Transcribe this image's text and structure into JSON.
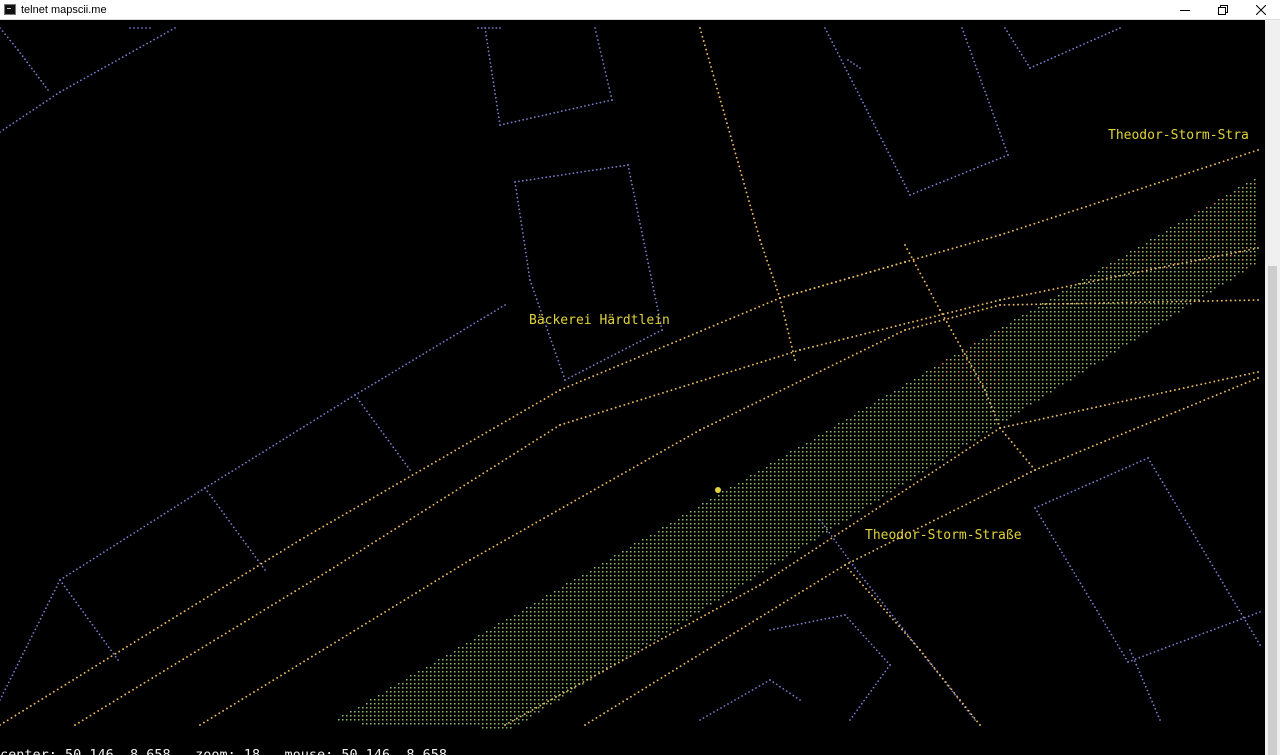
{
  "window": {
    "title": "telnet mapscii.me",
    "icon": "terminal-icon",
    "controls": [
      "minimize-icon",
      "restore-icon",
      "close-icon"
    ]
  },
  "map": {
    "labels": [
      {
        "text": "Theodor-Storm-Stra"
      },
      {
        "text": "Bäckerei Härdtlein"
      },
      {
        "text": "Theodor-Storm-Straße"
      }
    ],
    "colors": {
      "building": "#7c7ccc",
      "road": "#e8b860",
      "park": "#8fbf70",
      "label": "#e0d23c",
      "marker": "#e0d23c"
    }
  },
  "status": {
    "text": "center: 50.146, 8.658   zoom: 18   mouse: 50.146, 8.658"
  }
}
